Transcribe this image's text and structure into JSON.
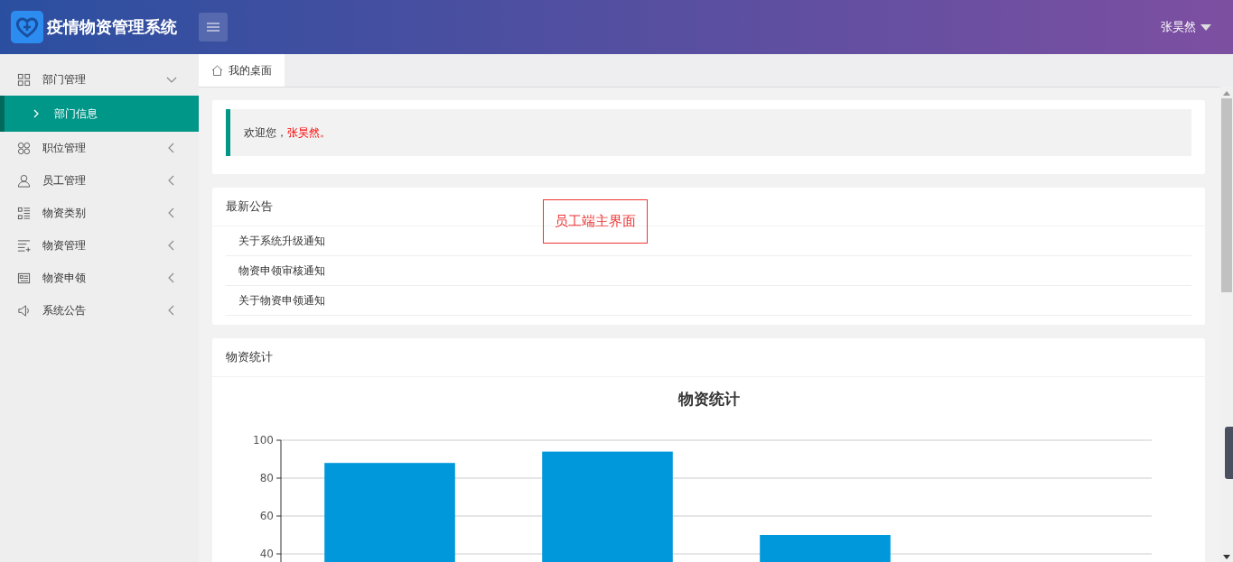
{
  "header": {
    "title": "疫情物资管理系统",
    "user": "张昊然"
  },
  "sidebar": {
    "items": [
      {
        "label": "部门管理",
        "expanded": true,
        "children": [
          {
            "label": "部门信息",
            "selected": true
          }
        ]
      },
      {
        "label": "职位管理",
        "expanded": false
      },
      {
        "label": "员工管理",
        "expanded": false
      },
      {
        "label": "物资类别",
        "expanded": false
      },
      {
        "label": "物资管理",
        "expanded": false
      },
      {
        "label": "物资申领",
        "expanded": false
      },
      {
        "label": "系统公告",
        "expanded": false
      }
    ]
  },
  "tabs": [
    {
      "label": "我的桌面",
      "selected": true
    }
  ],
  "welcome": {
    "text": "欢迎您，",
    "name": "张昊然。"
  },
  "notices": {
    "title": "最新公告",
    "items": [
      "关于系统升级通知",
      "物资申领审核通知",
      "关于物资申领通知"
    ]
  },
  "annotation": "员工端主界面",
  "stats": {
    "title": "物资统计",
    "chart_data": {
      "type": "bar",
      "title": "物资统计",
      "values": [
        88,
        94,
        50,
        null
      ],
      "ylim": [
        0,
        100
      ],
      "grid": true,
      "yticks": [
        40,
        60,
        80,
        100
      ]
    }
  }
}
